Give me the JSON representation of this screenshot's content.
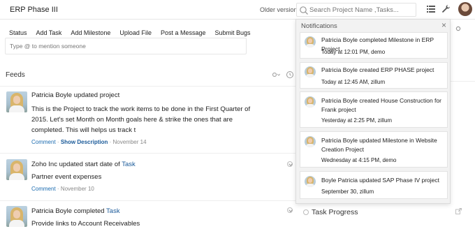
{
  "header": {
    "project_title": "ERP Phase III",
    "older_version": "Older version",
    "search_placeholder": "Search Project Name ,Tasks..."
  },
  "actions": {
    "tabs": [
      "Status",
      "Add Task",
      "Add Milestone",
      "Upload File",
      "Post a Message",
      "Submit Bugs"
    ],
    "mention_placeholder": "Type @ to mention someone"
  },
  "feeds": {
    "title": "Feeds",
    "items": [
      {
        "author": "Patricia Boyle",
        "action": "updated project",
        "link": "",
        "body_lines": [
          "This is the Project to track the work items to be done in the First Quarter of",
          "2015. Let's set Month on Month goals here & strike the ones that are",
          "completed.  This will helps us track t"
        ],
        "comment": "Comment",
        "show_description": "Show Description",
        "date": "November 14"
      },
      {
        "author": "Zoho Inc",
        "action": "updated start date of",
        "link": "Task",
        "title": "Partner event expenses",
        "comment": "Comment",
        "date": "November 10"
      },
      {
        "author": "Patricia Boyle",
        "action": "completed",
        "link": "Task",
        "title": "Provide links to Account Receivables"
      }
    ]
  },
  "right_panel": {
    "task_progress": "Task Progress"
  },
  "notifications": {
    "header": "Notifications",
    "items": [
      {
        "text": "Patricia Boyle completed Milestone in ERP Project",
        "time": "Today at 12:01 PM, demo"
      },
      {
        "text": "Patricia Boyle created ERP PHASE project",
        "time": "Today at 12:45 AM, zillum"
      },
      {
        "text": "Patricia Boyle created House Construction for Frank project",
        "time": "Yesterday at 2:25 PM, zillum"
      },
      {
        "text": "Patricia Boyle updated Milestone in Website Creation Project",
        "time": "Wednesday at 4:15 PM, demo"
      },
      {
        "text": "Boyle Patricia updated SAP Phase IV project",
        "time": "September 30, zillum"
      }
    ]
  }
}
